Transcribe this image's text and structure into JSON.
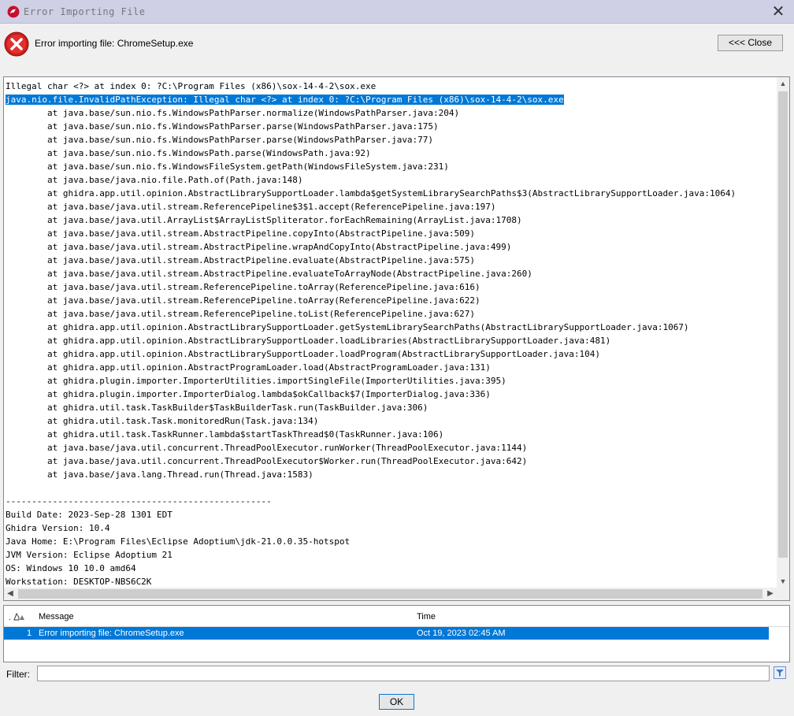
{
  "window": {
    "title": "Error Importing File"
  },
  "header": {
    "message": "Error importing file: ChromeSetup.exe",
    "close_label": "<<< Close"
  },
  "trace": {
    "lines": [
      "Illegal char <?> at index 0: ?C:\\Program Files (x86)\\sox-14-4-2\\sox.exe",
      "java.nio.file.InvalidPathException: Illegal char <?> at index 0: ?C:\\Program Files (x86)\\sox-14-4-2\\sox.exe",
      "\tat java.base/sun.nio.fs.WindowsPathParser.normalize(WindowsPathParser.java:204)",
      "\tat java.base/sun.nio.fs.WindowsPathParser.parse(WindowsPathParser.java:175)",
      "\tat java.base/sun.nio.fs.WindowsPathParser.parse(WindowsPathParser.java:77)",
      "\tat java.base/sun.nio.fs.WindowsPath.parse(WindowsPath.java:92)",
      "\tat java.base/sun.nio.fs.WindowsFileSystem.getPath(WindowsFileSystem.java:231)",
      "\tat java.base/java.nio.file.Path.of(Path.java:148)",
      "\tat ghidra.app.util.opinion.AbstractLibrarySupportLoader.lambda$getSystemLibrarySearchPaths$3(AbstractLibrarySupportLoader.java:1064)",
      "\tat java.base/java.util.stream.ReferencePipeline$3$1.accept(ReferencePipeline.java:197)",
      "\tat java.base/java.util.ArrayList$ArrayListSpliterator.forEachRemaining(ArrayList.java:1708)",
      "\tat java.base/java.util.stream.AbstractPipeline.copyInto(AbstractPipeline.java:509)",
      "\tat java.base/java.util.stream.AbstractPipeline.wrapAndCopyInto(AbstractPipeline.java:499)",
      "\tat java.base/java.util.stream.AbstractPipeline.evaluate(AbstractPipeline.java:575)",
      "\tat java.base/java.util.stream.AbstractPipeline.evaluateToArrayNode(AbstractPipeline.java:260)",
      "\tat java.base/java.util.stream.ReferencePipeline.toArray(ReferencePipeline.java:616)",
      "\tat java.base/java.util.stream.ReferencePipeline.toArray(ReferencePipeline.java:622)",
      "\tat java.base/java.util.stream.ReferencePipeline.toList(ReferencePipeline.java:627)",
      "\tat ghidra.app.util.opinion.AbstractLibrarySupportLoader.getSystemLibrarySearchPaths(AbstractLibrarySupportLoader.java:1067)",
      "\tat ghidra.app.util.opinion.AbstractLibrarySupportLoader.loadLibraries(AbstractLibrarySupportLoader.java:481)",
      "\tat ghidra.app.util.opinion.AbstractLibrarySupportLoader.loadProgram(AbstractLibrarySupportLoader.java:104)",
      "\tat ghidra.app.util.opinion.AbstractProgramLoader.load(AbstractProgramLoader.java:131)",
      "\tat ghidra.plugin.importer.ImporterUtilities.importSingleFile(ImporterUtilities.java:395)",
      "\tat ghidra.plugin.importer.ImporterDialog.lambda$okCallback$7(ImporterDialog.java:336)",
      "\tat ghidra.util.task.TaskBuilder$TaskBuilderTask.run(TaskBuilder.java:306)",
      "\tat ghidra.util.task.Task.monitoredRun(Task.java:134)",
      "\tat ghidra.util.task.TaskRunner.lambda$startTaskThread$0(TaskRunner.java:106)",
      "\tat java.base/java.util.concurrent.ThreadPoolExecutor.runWorker(ThreadPoolExecutor.java:1144)",
      "\tat java.base/java.util.concurrent.ThreadPoolExecutor$Worker.run(ThreadPoolExecutor.java:642)",
      "\tat java.base/java.lang.Thread.run(Thread.java:1583)",
      "",
      "---------------------------------------------------",
      "Build Date: 2023-Sep-28 1301 EDT",
      "Ghidra Version: 10.4",
      "Java Home: E:\\Program Files\\Eclipse Adoptium\\jdk-21.0.0.35-hotspot",
      "JVM Version: Eclipse Adoptium 21",
      "OS: Windows 10 10.0 amd64",
      "Workstation: DESKTOP-NBS6C2K"
    ],
    "highlighted_line": 1
  },
  "log_table": {
    "columns": {
      "icon_header": ".",
      "message": "Message",
      "time": "Time"
    },
    "rows": [
      {
        "index": "1",
        "message": "Error importing file: ChromeSetup.exe",
        "time": "Oct 19, 2023 02:45 AM"
      }
    ]
  },
  "filter": {
    "label": "Filter:",
    "value": ""
  },
  "footer": {
    "ok_label": "OK"
  },
  "icons": {
    "app": "ghidra-dragon-icon",
    "error": "error-x-icon",
    "sort": "sort-icon",
    "filter": "filter-options-icon"
  },
  "colors": {
    "selection": "#0078d7",
    "error_red": "#cc1e1e",
    "titlebar": "#cfcfe6"
  }
}
